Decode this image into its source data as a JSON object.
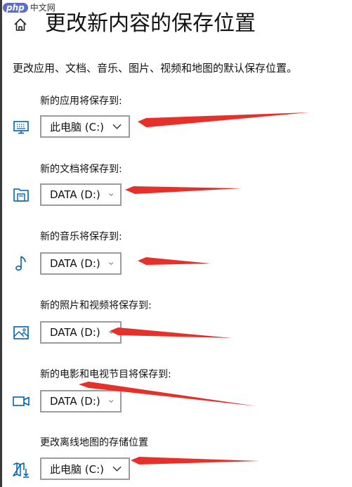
{
  "watermark": {
    "logo": "php",
    "text": "中文网"
  },
  "header": {
    "title": "更改新内容的保存位置"
  },
  "description": "更改应用、文档、音乐、图片、视频和地图的默认保存位置。",
  "settings": [
    {
      "label": "新的应用将保存到:",
      "icon": "monitor-icon",
      "value": "此电脑 (C:)"
    },
    {
      "label": "新的文档将保存到:",
      "icon": "documents-folder-icon",
      "value": "DATA (D:)"
    },
    {
      "label": "新的音乐将保存到:",
      "icon": "music-note-icon",
      "value": "DATA (D:)"
    },
    {
      "label": "新的照片和视频将保存到:",
      "icon": "picture-icon",
      "value": "DATA (D:)"
    },
    {
      "label": "新的电影和电视节目将保存到:",
      "icon": "video-camera-icon",
      "value": "DATA (D:)"
    },
    {
      "label": "更改离线地图的存储位置",
      "icon": "map-download-icon",
      "value": "此电脑 (C:)"
    }
  ],
  "colors": {
    "icon_blue": "#0063b1",
    "annotation_red": "#e8302a",
    "dropdown_border": "#9c9c9c"
  }
}
